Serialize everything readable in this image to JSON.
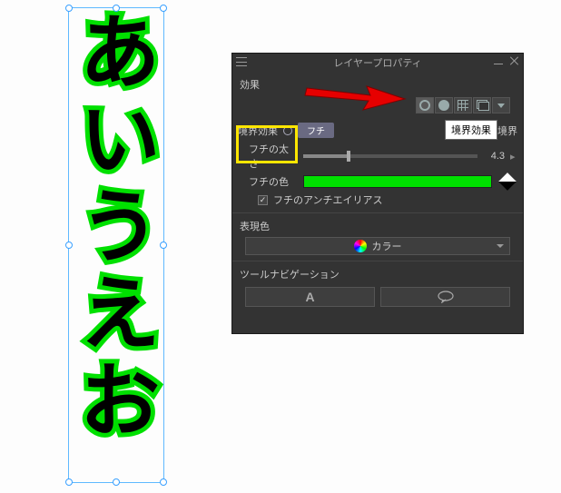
{
  "canvas": {
    "text_content": "あいうえお"
  },
  "panel": {
    "title": "レイヤープロパティ",
    "effect_label": "効果",
    "boundary_effect_label": "境界効果",
    "boundary_pill": "フチ",
    "watercolor_label": "水彩境界",
    "thickness_label": "フチの太さ",
    "thickness_value": "4.3",
    "color_label": "フチの色",
    "antialias_label": "フチのアンチエイリアス",
    "antialias_checked": true,
    "expression_label": "表現色",
    "expression_dropdown": "カラー",
    "toolnav_label": "ツールナビゲーション",
    "outline_color": "#00e000"
  },
  "tooltip": {
    "text": "境界効果"
  }
}
